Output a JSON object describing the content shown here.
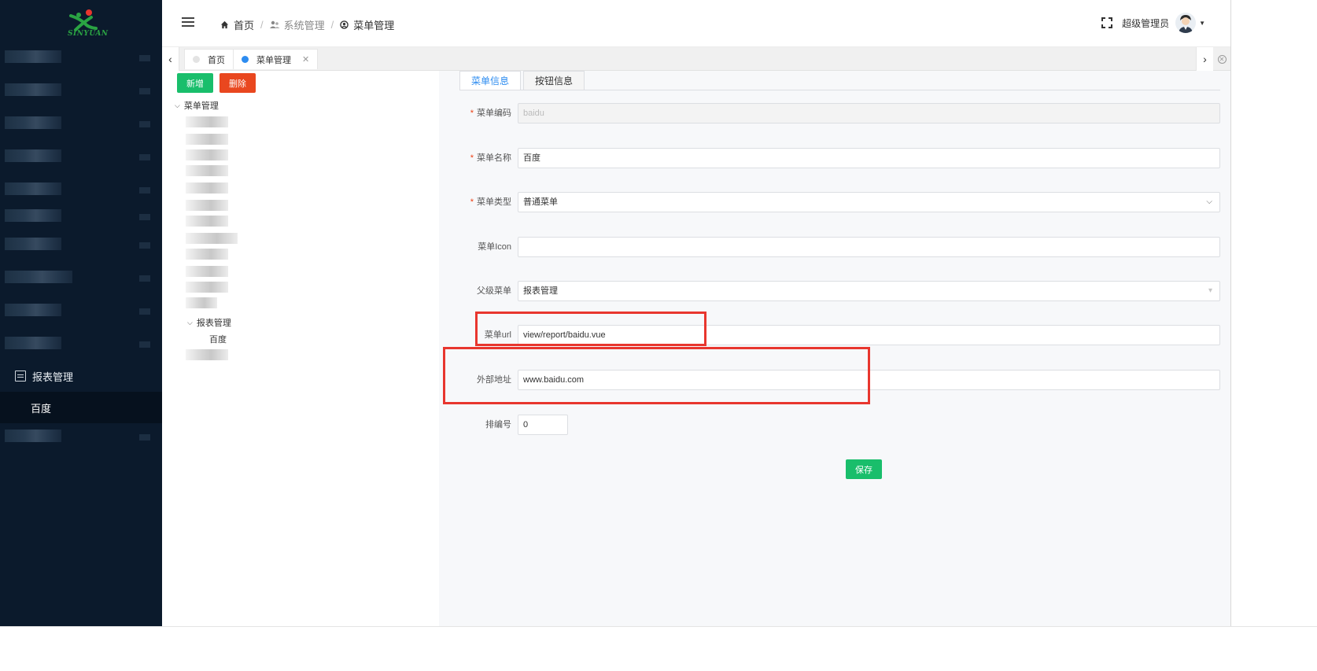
{
  "app": {
    "logo_text": "SINYUAN",
    "brand_color": "#2aa343"
  },
  "sidebar": {
    "group_label": "报表管理",
    "sub_item": "百度"
  },
  "header": {
    "breadcrumbs": [
      "首页",
      "系统管理",
      "菜单管理"
    ],
    "username": "超级管理员"
  },
  "tabs": [
    {
      "label": "首页",
      "active": false
    },
    {
      "label": "菜单管理",
      "active": true
    }
  ],
  "left": {
    "add_label": "新增",
    "delete_label": "删除",
    "tree_root": "菜单管理",
    "tree_group": "报表管理",
    "tree_leaf": "百度"
  },
  "form": {
    "tabs": [
      "菜单信息",
      "按钮信息"
    ],
    "fields": {
      "code": {
        "label": "菜单编码",
        "value": "baidu",
        "required": true
      },
      "name": {
        "label": "菜单名称",
        "value": "百度",
        "required": true
      },
      "type": {
        "label": "菜单类型",
        "value": "普通菜单",
        "required": true
      },
      "icon": {
        "label": "菜单Icon",
        "value": ""
      },
      "parent": {
        "label": "父级菜单",
        "value": "报表管理"
      },
      "url": {
        "label": "菜单url",
        "value": "view/report/baidu.vue"
      },
      "external": {
        "label": "外部地址",
        "value": "www.baidu.com"
      },
      "sort": {
        "label": "排编号",
        "value": "0"
      }
    },
    "save_label": "保存"
  },
  "colors": {
    "success": "#19be6b",
    "danger": "#e9471f",
    "primary": "#2d8cf0",
    "highlight": "#e8362e",
    "sidebar_bg": "#0b1a2c"
  }
}
